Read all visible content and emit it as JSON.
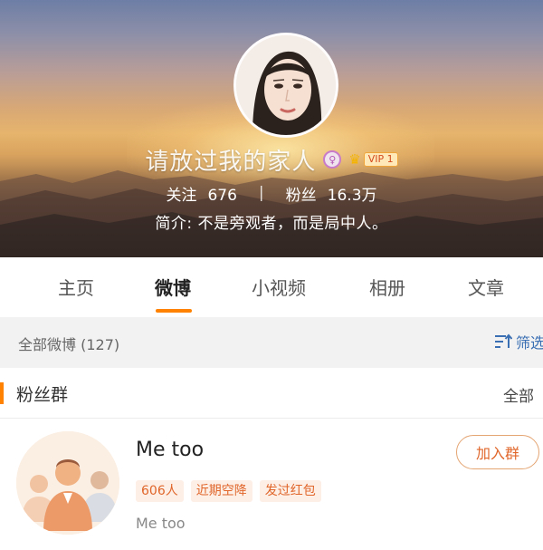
{
  "profile": {
    "nickname": "请放过我的家人",
    "gender_symbol": "♀",
    "vip_label": "VIP 1",
    "stats": {
      "following_label": "关注",
      "following_count": "676",
      "separator": "|",
      "followers_label": "粉丝",
      "followers_count": "16.3万"
    },
    "bio": "简介: 不是旁观者，而是局中人。"
  },
  "tabs": [
    {
      "label": "主页",
      "active": false
    },
    {
      "label": "微博",
      "active": true
    },
    {
      "label": "小视频",
      "active": false
    },
    {
      "label": "相册",
      "active": false
    },
    {
      "label": "文章",
      "active": false
    }
  ],
  "filter": {
    "count_label": "全部微博 (127)",
    "filter_label": "筛选"
  },
  "fan_group": {
    "title": "粉丝群",
    "all_label": "全部",
    "card": {
      "name": "Me too",
      "tags": [
        "606人",
        "近期空降",
        "发过红包"
      ],
      "description": "Me too",
      "join_label": "加入群"
    }
  },
  "colors": {
    "accent_orange": "#ff8200",
    "filter_blue": "#3a6fb3",
    "tag_text": "#e0662a",
    "tag_bg": "#fdeee6"
  },
  "icons": {
    "gender": "female-gender-icon",
    "vip": "vip-crown-icon",
    "filter": "filter-sort-icon"
  }
}
